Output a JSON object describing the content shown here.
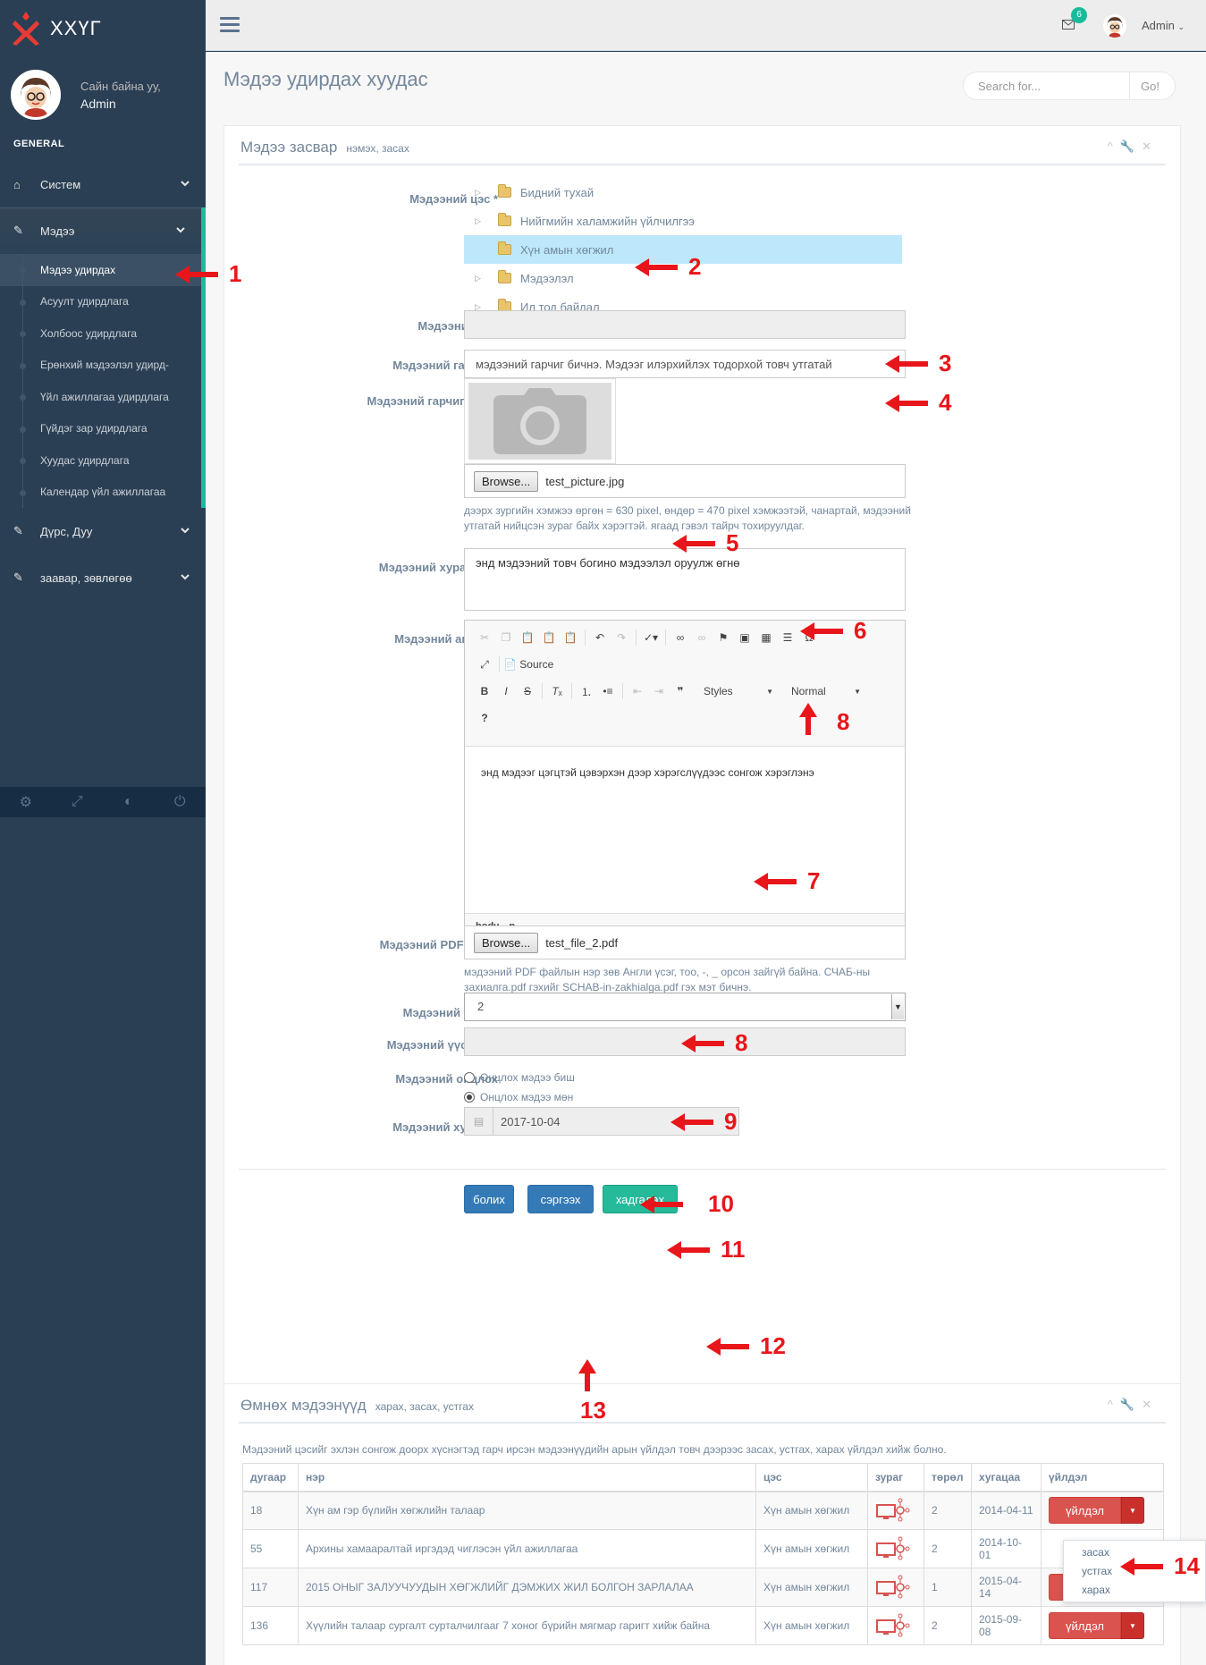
{
  "brand": {
    "name": "ХХҮГ"
  },
  "profile": {
    "greeting": "Сайн байна уу,",
    "name": "Admin"
  },
  "sidebar": {
    "section": "GENERAL",
    "system": "Систем",
    "news": "Мэдээ",
    "subitems": [
      "Мэдээ удирдах",
      "Асуулт удирдлага",
      "Холбоос удирдлага",
      "Ерөнхий мэдээлэл удирд-",
      "Үйл ажиллагаа удирдлага",
      "Гүйдэг зар удирдлага",
      "Хуудас удирдлага",
      "Календар үйл ажиллагаа"
    ],
    "gallery": "Дүрс, Дуу",
    "guide": "заавар, зөвлөгөө"
  },
  "topnav": {
    "badge": "6",
    "user": "Admin"
  },
  "page": {
    "title": "Мэдээ удирдах хуудас",
    "search_placeholder": "Search for...",
    "search_btn": "Go!"
  },
  "edit_panel": {
    "title": "Мэдээ засвар",
    "subtitle": "нэмэх, засах",
    "labels": {
      "category": "Мэдээний цэс *",
      "id": "Мэдээний ID *",
      "headline": "Мэдээний гарчиг *",
      "headline_image": "Мэдээний гарчиг зураг",
      "summary": "Мэдээний хураангуй",
      "content": "Мэдээний агуулга",
      "pdf": "Мэдээний PDF файл",
      "type": "Мэдээний төрөл",
      "author": "Мэдээний үүсгэсэн",
      "featured": "Мэдээний онцлох",
      "date": "Мэдээний хугацаа"
    },
    "tree": [
      "Бидний тухай",
      " Нийгмийн халамжийн үйлчилгээ",
      "Хүн амын хөгжил",
      "Мэдээлэл",
      "Ил тод байдал"
    ],
    "headline_value": "мэдээний гарчиг бичнэ. Мэдээг илэрхийлэх тодорхой товч утгатай",
    "browse": "Browse...",
    "image_file": "test_picture.jpg",
    "image_help": "дээрх зургийн хэмжээ өргөн = 630 pixel, өндөр = 470 pixel хэмжээтэй, чанартай, мэдээний утгатай нийцсэн зураг байх хэрэгтэй. ягаад гэвэл тайрч тохируулдаг.",
    "summary_value": "энд мэдээний товч богино мэдээлэл оруулж өгнө",
    "editor": {
      "source": "Source",
      "styles": "Styles",
      "format": "Normal",
      "body": "энд мэдээг цэгцтэй цэвэрхэн дээр хэрэгслүүдээс сонгож хэрэглэнэ",
      "path": "body p"
    },
    "pdf_file": "test_file_2.pdf",
    "pdf_help": "мэдээний PDF файлын нэр зөв Англи үсэг, тоо, -, _ орсон зайгүй байна. СЧАБ-ны захиалга.pdf гэхийг SCHAB-in-zakhialga.pdf гэх мэт бичнэ.",
    "type_value": "2",
    "radio_no": "Онцлох мэдээ биш",
    "radio_yes": "Онцлох мэдээ мөн",
    "date_value": "2017-10-04",
    "buttons": {
      "cancel": "болих",
      "refresh": "сэргээх",
      "save": "хадгалах"
    }
  },
  "list_panel": {
    "title": "Өмнөх мэдээнүүд",
    "subtitle": "харах, засах, устгах",
    "description": "Мэдээний цэсийг эхлэн сонгож доорх хүснэгтэд гарч ирсэн мэдээнүүдийн арын үйлдэл товч дээрээс засах, устгах, харах үйлдэл хийж болно.",
    "headers": [
      "дугаар",
      "нэр",
      "цэс",
      "зураг",
      "төрөл",
      "хугацаа",
      "үйлдэл"
    ],
    "rows": [
      {
        "id": "18",
        "name": "Хүн ам гэр бүлийн хөгжлийн талаар",
        "menu": "Хүн амын хөгжил",
        "type": "2",
        "date": "2014-04-11"
      },
      {
        "id": "55",
        "name": "Архины хамааралтай иргэдэд чиглэсэн үйл ажиллагаа",
        "menu": "Хүн амын хөгжил",
        "type": "2",
        "date": "2014-10-01"
      },
      {
        "id": "117",
        "name": "2015 ОНЫГ ЗАЛУУЧУУДЫН ХӨГЖЛИЙГ ДЭМЖИХ ЖИЛ БОЛГОН ЗАРЛАЛАА",
        "menu": "Хүн амын хөгжил",
        "type": "1",
        "date": "2015-04-14"
      },
      {
        "id": "136",
        "name": "Хүүлийн талаар сургалт сурталчилгааг 7 хоног бүрийн мягмар гаригт хийж байна",
        "menu": "Хүн амын хөгжил",
        "type": "2",
        "date": "2015-09-08"
      }
    ],
    "action": "үйлдэл",
    "dropdown": [
      "засах",
      "устгах",
      "харах"
    ]
  },
  "annotations": [
    "1",
    "2",
    "3",
    "4",
    "5",
    "6",
    "7",
    "8",
    "8",
    "9",
    "10",
    "11",
    "12",
    "13",
    "14"
  ],
  "colors": {
    "sidebar": "#2a3f54",
    "accent": "#1abb9c",
    "primary": "#337ab7",
    "success": "#26b99a",
    "danger": "#d9534f",
    "annotation": "#e8161a"
  }
}
